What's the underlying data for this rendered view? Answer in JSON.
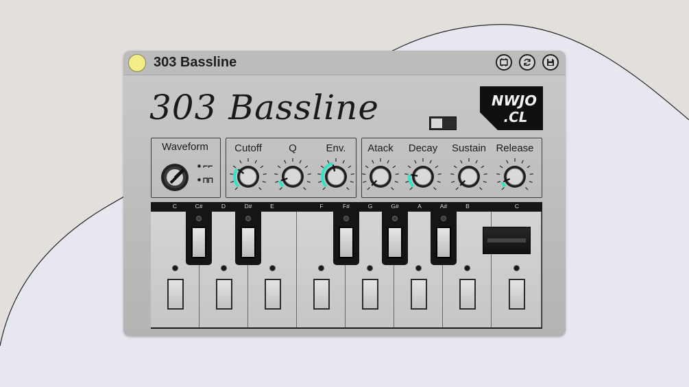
{
  "background": {
    "page_color": "#e2dfdd",
    "blob_color": "#e6e7ef"
  },
  "window": {
    "title": "303 Bassline",
    "status_led_color": "#f4ec87",
    "buttons": [
      {
        "name": "device-button",
        "icon": "device-icon"
      },
      {
        "name": "refresh-button",
        "icon": "refresh-icon"
      },
      {
        "name": "save-button",
        "icon": "save-icon"
      }
    ]
  },
  "panel": {
    "title": "303 Bassline",
    "logo_text": [
      "NWJO",
      ".CL"
    ]
  },
  "waveform": {
    "label": "Waveform",
    "options": [
      "⌐⌐",
      "⊓⊓"
    ],
    "selected": 0
  },
  "filter": {
    "knobs": [
      {
        "label": "Cutoff",
        "value": 0.3
      },
      {
        "label": "Q",
        "value": 0.1
      },
      {
        "label": "Env.",
        "value": 0.45
      }
    ]
  },
  "envelope": {
    "knobs": [
      {
        "label": "Atack",
        "value": 0.0
      },
      {
        "label": "Decay",
        "value": 0.2
      },
      {
        "label": "Sustain",
        "value": 0.0
      },
      {
        "label": "Release",
        "value": 0.08
      }
    ]
  },
  "accent_color": "#2ee6c4",
  "keyboard": {
    "notes": [
      "C",
      "C#",
      "D",
      "D#",
      "E",
      "F",
      "F#",
      "G",
      "G#",
      "A",
      "A#",
      "B",
      "C"
    ]
  }
}
